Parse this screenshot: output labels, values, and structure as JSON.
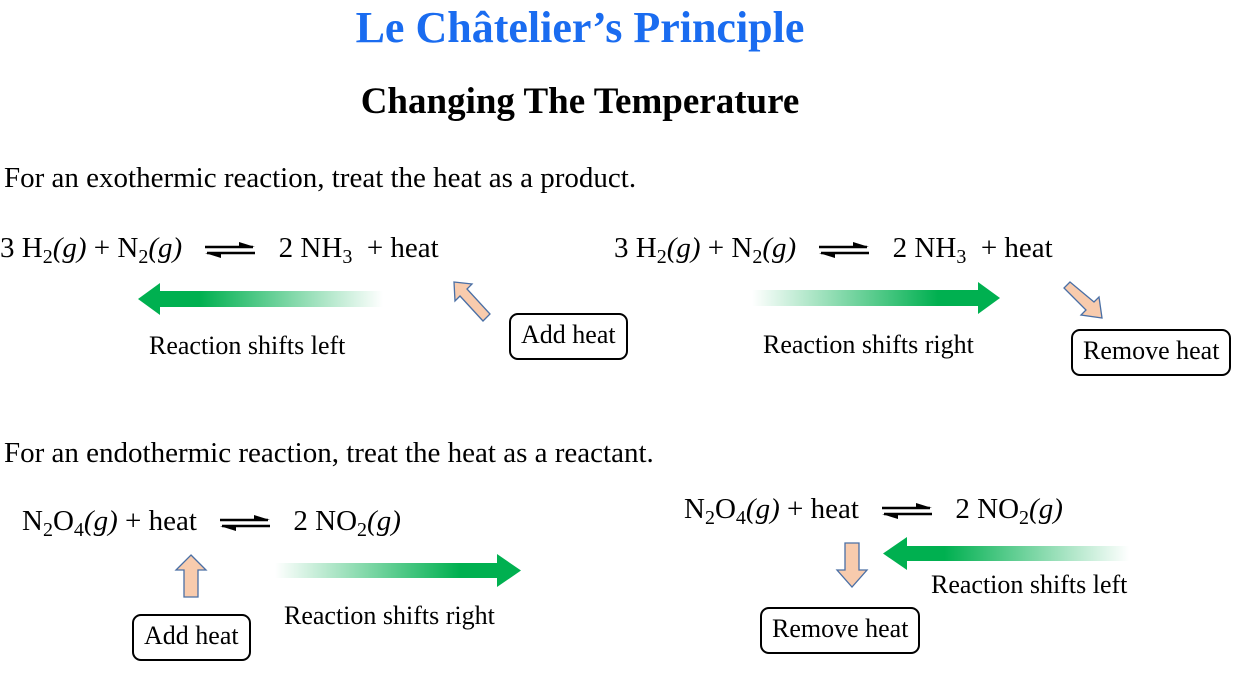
{
  "title": "Le Châtelier’s Principle",
  "subtitle": "Changing The Temperature",
  "colors": {
    "title": "#1a6cf0",
    "shift_arrow": "#00b050",
    "heat_arrow_fill": "#f8cbad",
    "heat_arrow_stroke": "#4a6fa5"
  },
  "exothermic": {
    "note": "For an exothermic reaction, treat the heat as a product.",
    "equation": {
      "reactants": [
        {
          "coef": "3 ",
          "formula": "H",
          "sub": "2",
          "state": "(g)"
        },
        {
          "coef": "",
          "formula": "N",
          "sub": "2",
          "state": "(g)"
        }
      ],
      "products": [
        {
          "coef": "2 ",
          "formula": "NH",
          "sub": "3",
          "state": ""
        }
      ],
      "heat": "heat",
      "plus": "+"
    },
    "panels": [
      {
        "action": "Add heat",
        "shift_label": "Reaction shifts left",
        "shift_direction": "left",
        "heat_arrow": "up-left"
      },
      {
        "action": "Remove heat",
        "shift_label": "Reaction shifts right",
        "shift_direction": "right",
        "heat_arrow": "down-right"
      }
    ]
  },
  "endothermic": {
    "note": "For an endothermic reaction, treat the heat as a reactant.",
    "equation": {
      "reactants": [
        {
          "formula": "N",
          "sub": "2",
          "formula2": "O",
          "sub2": "4",
          "state": "(g)"
        }
      ],
      "products": [
        {
          "coef": "2 ",
          "formula": "NO",
          "sub": "2",
          "state": "(g)"
        }
      ],
      "heat": "heat",
      "plus": "+"
    },
    "panels": [
      {
        "action": "Add heat",
        "shift_label": "Reaction shifts right",
        "shift_direction": "right",
        "heat_arrow": "up"
      },
      {
        "action": "Remove heat",
        "shift_label": "Reaction shifts left",
        "shift_direction": "left",
        "heat_arrow": "down"
      }
    ]
  }
}
